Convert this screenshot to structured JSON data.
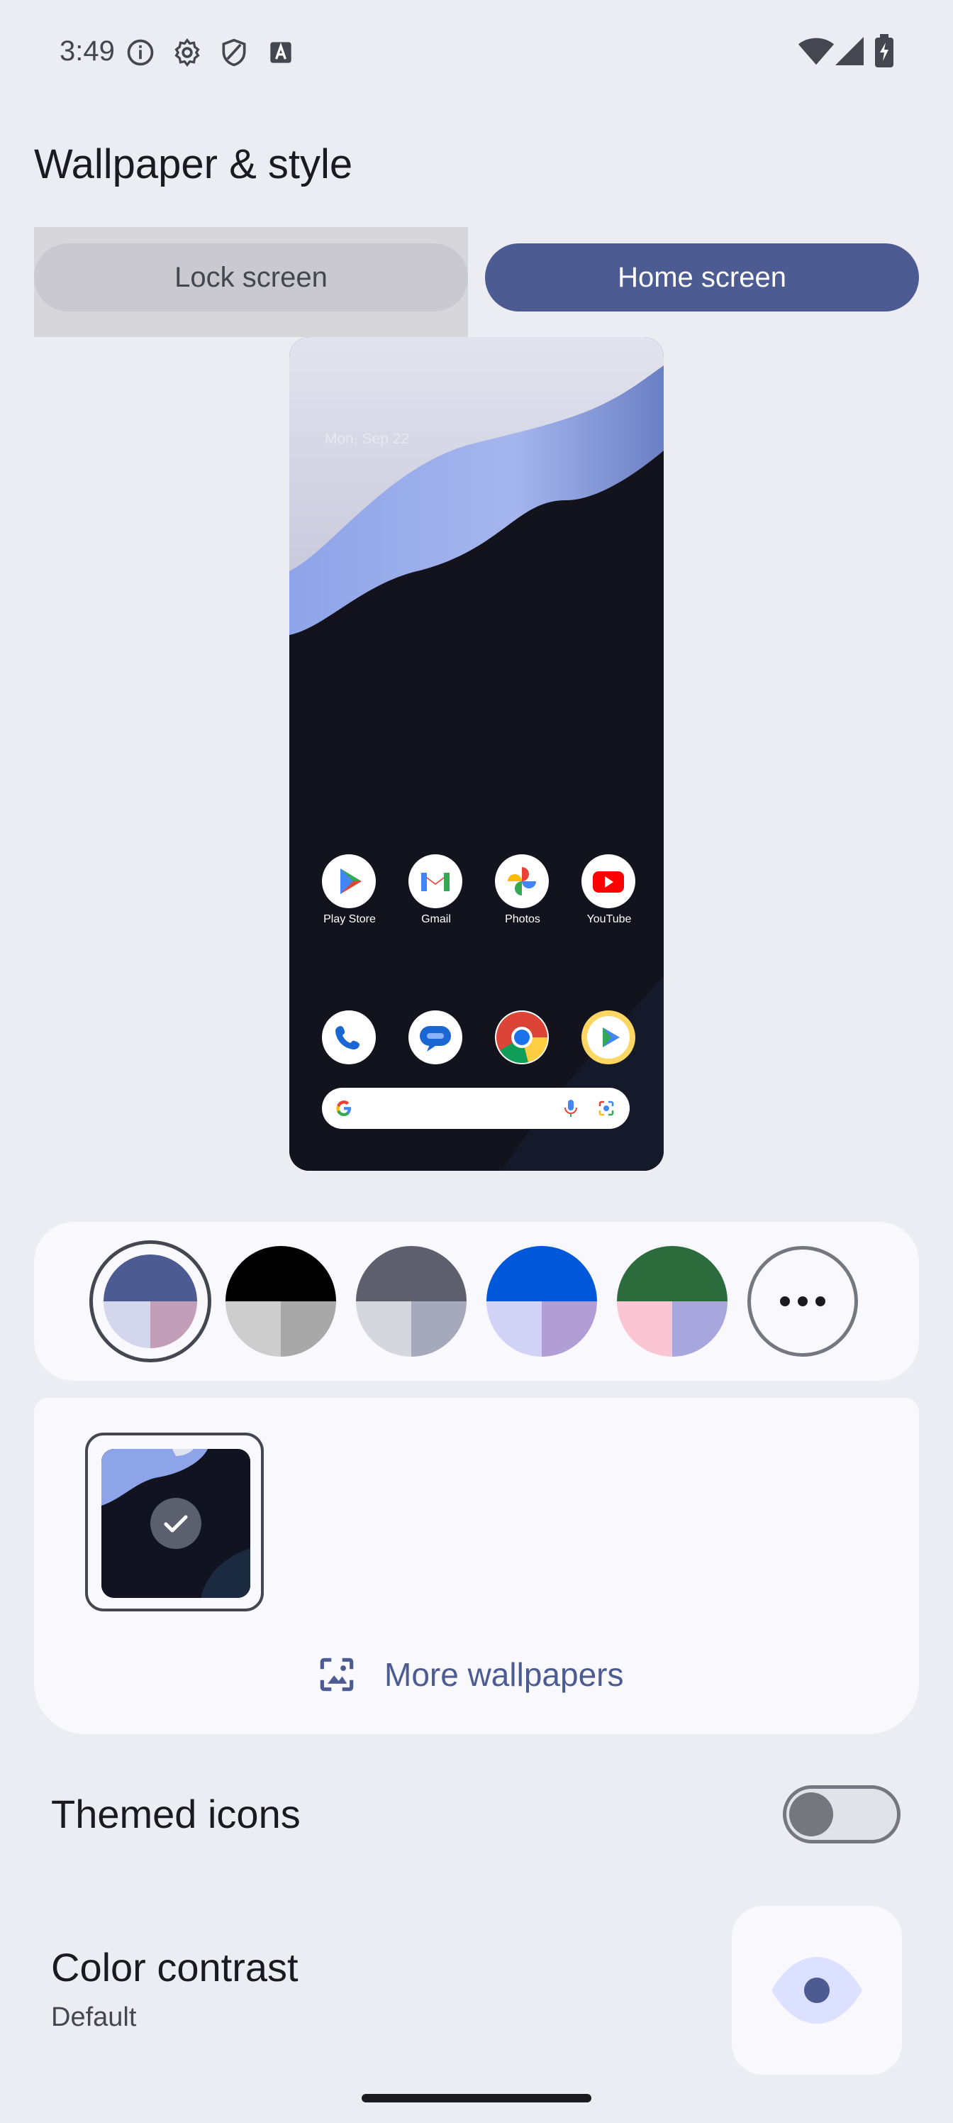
{
  "status_bar": {
    "time": "3:49",
    "left_icons": [
      "info-icon",
      "gear-icon",
      "shield-icon",
      "font-a-icon"
    ],
    "right_icons": [
      "wifi-icon",
      "cell-signal-icon",
      "battery-charging-icon"
    ]
  },
  "page": {
    "title": "Wallpaper & style"
  },
  "tabs": [
    {
      "label": "Lock screen",
      "selected": false
    },
    {
      "label": "Home screen",
      "selected": true
    }
  ],
  "preview": {
    "date": "Mon, Sep 22",
    "apps_row1": [
      {
        "name": "Play Store",
        "icon": "play-store-icon"
      },
      {
        "name": "Gmail",
        "icon": "gmail-icon"
      },
      {
        "name": "Photos",
        "icon": "photos-icon"
      },
      {
        "name": "YouTube",
        "icon": "youtube-icon"
      }
    ],
    "dock_icons": [
      "phone-icon",
      "messages-icon",
      "chrome-icon",
      "play-games-icon"
    ],
    "search_bar_icons": [
      "google-g-icon",
      "mic-icon",
      "lens-icon"
    ]
  },
  "color_options": [
    {
      "top": "#4c5b92",
      "bl": "#d4d6ee",
      "br": "#c29eb8",
      "selected": true
    },
    {
      "top": "#000000",
      "bl": "#cdcdcd",
      "br": "#a8a8a8",
      "selected": false
    },
    {
      "top": "#5d5f6c",
      "bl": "#d5d6de",
      "br": "#a6a9bb",
      "selected": false
    },
    {
      "top": "#0057d9",
      "bl": "#d2d2f7",
      "br": "#b19ed4",
      "selected": false
    },
    {
      "top": "#2c6b3b",
      "bl": "#fbc5d3",
      "br": "#a7a7de",
      "selected": false
    }
  ],
  "more_colors_icon": "more-horiz-icon",
  "wallpaper": {
    "selected_icon": "checkmark-icon",
    "more_label": "More wallpapers",
    "more_icon": "wallpaper-image-icon"
  },
  "settings": {
    "themed_icons": {
      "label": "Themed icons",
      "enabled": false
    },
    "color_contrast": {
      "label": "Color contrast",
      "value": "Default",
      "icon": "eye-icon"
    }
  },
  "colors": {
    "accent": "#4c5b92",
    "background": "#ececf3",
    "card": "#f8f8fd"
  }
}
